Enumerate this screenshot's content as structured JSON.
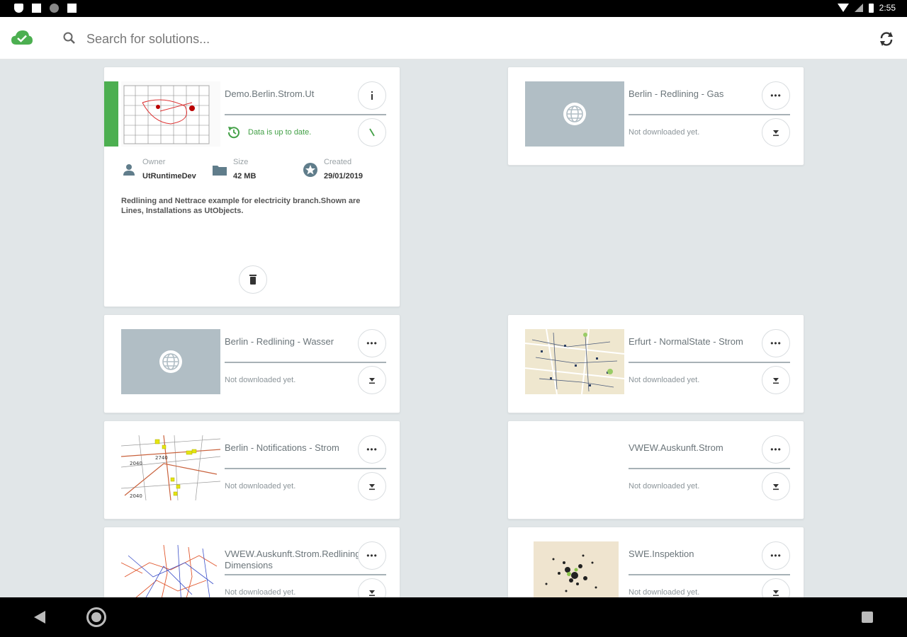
{
  "statusbar": {
    "time": "2:55"
  },
  "search": {
    "placeholder": "Search for solutions..."
  },
  "featured": {
    "title": "Demo.Berlin.Strom.Ut",
    "status": "Data is up to date.",
    "owner_label": "Owner",
    "owner_value": "UtRuntimeDev",
    "size_label": "Size",
    "size_value": "42 MB",
    "created_label": "Created",
    "created_value": "29/01/2019",
    "description": "Redlining and Nettrace example for electricity branch.Shown are Lines, Installations as UtObjects."
  },
  "solutions": [
    {
      "title": "Berlin - Redlining - Gas",
      "status": "Not downloaded yet."
    },
    {
      "title": "Berlin - Redlining - Wasser",
      "status": "Not downloaded yet."
    },
    {
      "title": "Erfurt - NormalState - Strom",
      "status": "Not downloaded yet."
    },
    {
      "title": "Berlin - Notifications - Strom",
      "status": "Not downloaded yet."
    },
    {
      "title": "VWEW.Auskunft.Strom",
      "status": "Not downloaded yet."
    },
    {
      "title": "VWEW.Auskunft.Strom.Redlining Dimensions",
      "status": "Not downloaded yet."
    },
    {
      "title": "SWE.Inspektion",
      "status": "Not downloaded yet."
    }
  ],
  "colors": {
    "accent": "#4caf50",
    "placeholder_thumb": "#b1bec5",
    "background": "#e1e6e8"
  },
  "icons": [
    "cloud-check-icon",
    "search-icon",
    "sync-icon",
    "info-icon",
    "download-icon",
    "globe-icon",
    "more-icon",
    "person-icon",
    "folder-icon",
    "star-icon",
    "trash-icon"
  ]
}
